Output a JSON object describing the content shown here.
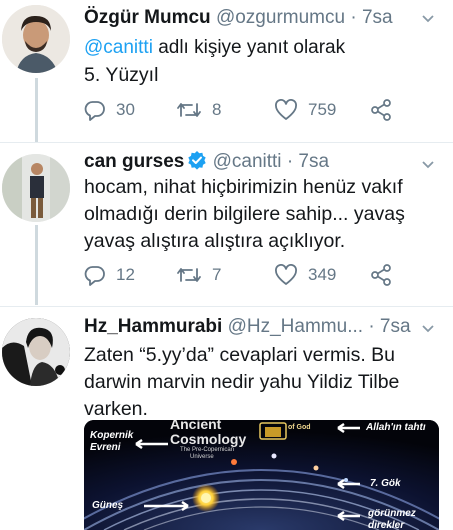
{
  "tweets": [
    {
      "name": "Özgür Mumcu",
      "handle": "@ozgurmumcu",
      "dot": "·",
      "time": "7sa",
      "reply_handle": "@canitti",
      "reply_suffix": " adlı kişiye yanıt olarak",
      "text": "5. Yüzyıl",
      "replies": "30",
      "retweets": "8",
      "likes": "759"
    },
    {
      "name": "can gurses",
      "handle": "@canitti",
      "dot": "·",
      "time": "7sa",
      "text": "hocam, nihat hiçbirimizin henüz vakıf olmadığı derin bilgilere sahip... yavaş yavaş alıştıra alıştıra açıklıyor.",
      "replies": "12",
      "retweets": "7",
      "likes": "349"
    },
    {
      "name": "Hz_Hammurabi",
      "handle": "@Hz_Hammu...",
      "dot": "·",
      "time": "7sa",
      "text": "Zaten “5.yy’da” cevaplari vermis. Bu darwin marvin nedir yahu Yildiz Tilbe varken."
    }
  ],
  "media": {
    "title_line1": "Ancient",
    "title_line2": "Cosmology",
    "subtitle_line1": "The Pre-Copernican",
    "subtitle_line2": "Universe",
    "label_kopernik_1": "Kopernik",
    "label_kopernik_2": "Evreni",
    "label_of_god": "of God",
    "label_allah": "Allah'ın tahtı",
    "label_gok": "7. Gök",
    "label_gunes": "Güneş",
    "label_gorunmez_1": "görünmez",
    "label_gorunmez_2": "direkler"
  },
  "colors": {
    "link": "#1da1f2",
    "muted": "#657786",
    "verified": "#1da1f2"
  },
  "icons": [
    "chevron-down-icon",
    "reply-icon",
    "retweet-icon",
    "like-icon",
    "share-icon",
    "verified-badge-icon"
  ]
}
